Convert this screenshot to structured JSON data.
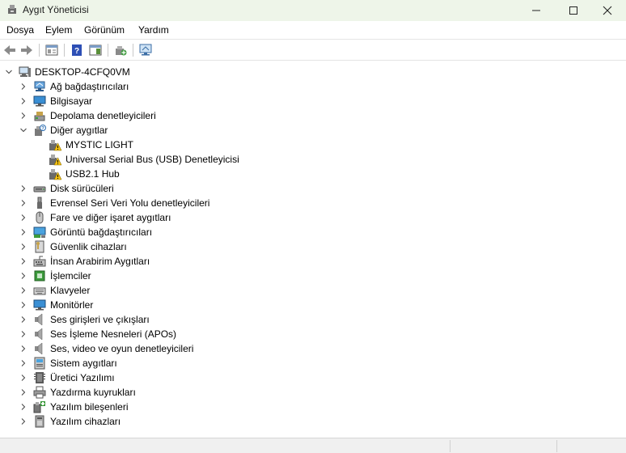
{
  "window": {
    "title": "Aygıt Yöneticisi",
    "minimize_glyph": "—",
    "maximize_glyph": "☐",
    "close_glyph": "✕"
  },
  "menu": [
    {
      "label": "Dosya"
    },
    {
      "label": "Eylem"
    },
    {
      "label": "Görünüm"
    },
    {
      "label": "Yardım"
    }
  ],
  "toolbar": [
    {
      "icon": "back-arrow-icon"
    },
    {
      "icon": "forward-arrow-icon"
    },
    {
      "icon": "properties-icon"
    },
    {
      "icon": "help-icon"
    },
    {
      "icon": "action-pane-icon"
    },
    {
      "icon": "update-driver-icon"
    },
    {
      "icon": "scan-hardware-icon"
    }
  ],
  "tree": {
    "root": {
      "label": "DESKTOP-4CFQ0VM",
      "icon": "computer-icon",
      "expanded": true
    },
    "categories": [
      {
        "label": "Ağ bağdaştırıcıları",
        "icon": "network-adapter-icon",
        "expanded": false
      },
      {
        "label": "Bilgisayar",
        "icon": "computer-monitor-icon",
        "expanded": false
      },
      {
        "label": "Depolama denetleyicileri",
        "icon": "storage-controller-icon",
        "expanded": false
      },
      {
        "label": "Diğer aygıtlar",
        "icon": "other-devices-icon",
        "expanded": true,
        "children": [
          {
            "label": "MYSTIC LIGHT",
            "icon": "warning-device-icon"
          },
          {
            "label": "Universal Serial Bus (USB) Denetleyicisi",
            "icon": "warning-device-icon"
          },
          {
            "label": "USB2.1 Hub",
            "icon": "warning-device-icon"
          }
        ]
      },
      {
        "label": "Disk sürücüleri",
        "icon": "disk-drive-icon",
        "expanded": false
      },
      {
        "label": "Evrensel Seri Veri Yolu denetleyicileri",
        "icon": "usb-icon",
        "expanded": false
      },
      {
        "label": "Fare ve diğer işaret aygıtları",
        "icon": "mouse-icon",
        "expanded": false
      },
      {
        "label": "Görüntü bağdaştırıcıları",
        "icon": "display-adapter-icon",
        "expanded": false
      },
      {
        "label": "Güvenlik cihazları",
        "icon": "security-device-icon",
        "expanded": false
      },
      {
        "label": "İnsan Arabirim Aygıtları",
        "icon": "hid-icon",
        "expanded": false
      },
      {
        "label": "İşlemciler",
        "icon": "processor-icon",
        "expanded": false
      },
      {
        "label": "Klavyeler",
        "icon": "keyboard-icon",
        "expanded": false
      },
      {
        "label": "Monitörler",
        "icon": "monitor-icon",
        "expanded": false
      },
      {
        "label": "Ses girişleri ve çıkışları",
        "icon": "speaker-icon",
        "expanded": false
      },
      {
        "label": "Ses İşleme Nesneleri (APOs)",
        "icon": "speaker-icon",
        "expanded": false
      },
      {
        "label": "Ses, video ve oyun denetleyicileri",
        "icon": "speaker-icon",
        "expanded": false
      },
      {
        "label": "Sistem aygıtları",
        "icon": "system-device-icon",
        "expanded": false
      },
      {
        "label": "Üretici Yazılımı",
        "icon": "firmware-icon",
        "expanded": false
      },
      {
        "label": "Yazdırma kuyrukları",
        "icon": "printer-icon",
        "expanded": false
      },
      {
        "label": "Yazılım bileşenleri",
        "icon": "software-component-icon",
        "expanded": false
      },
      {
        "label": "Yazılım cihazları",
        "icon": "software-device-icon",
        "expanded": false
      }
    ]
  },
  "colors": {
    "titlebar": "#eef5e9",
    "warning": "#f5c211",
    "icon_blue": "#2b6cb0"
  }
}
